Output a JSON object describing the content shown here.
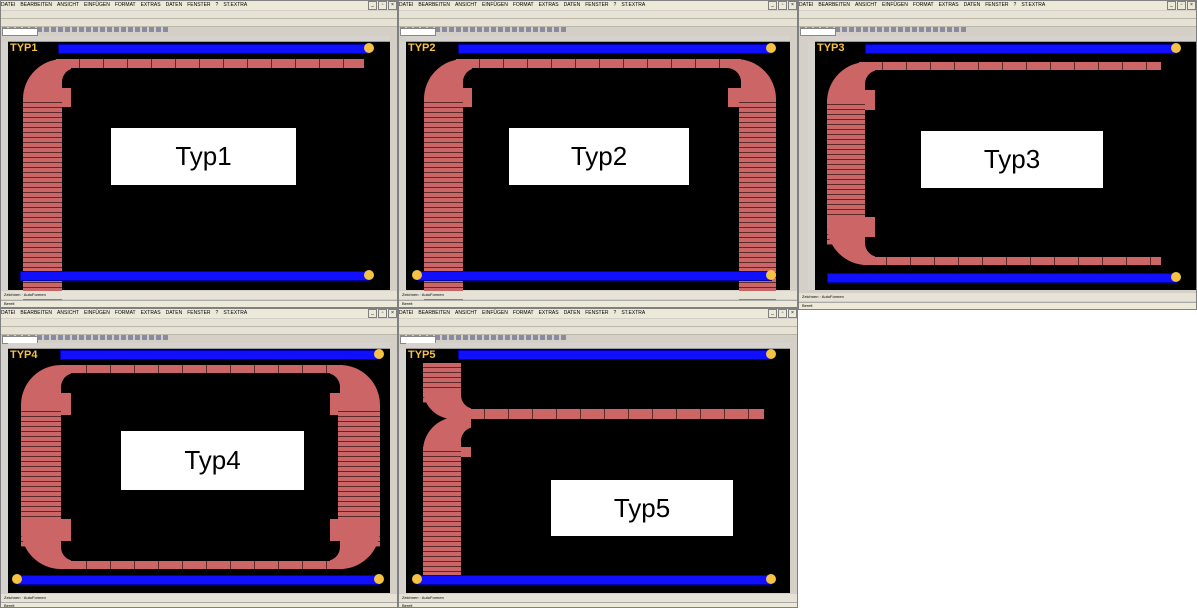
{
  "menu": [
    "Datei",
    "Bearbeiten",
    "Ansicht",
    "Einfügen",
    "Format",
    "Extras",
    "Daten",
    "Fenster",
    "?",
    "ST.Extra"
  ],
  "window_controls": [
    "_",
    "▫",
    "×"
  ],
  "zoom": "100%",
  "drawbar_text": "Zeichnen · AutoFormen",
  "status_text": "Bereit",
  "windows": [
    {
      "tag": "TYP1",
      "label": "Typ1"
    },
    {
      "tag": "TYP2",
      "label": "Typ2"
    },
    {
      "tag": "TYP3",
      "label": "Typ3"
    },
    {
      "tag": "TYP4",
      "label": "Typ4"
    },
    {
      "tag": "TYP5",
      "label": "Typ5"
    }
  ],
  "colors": {
    "sheet_bg": "#000000",
    "rail": "#1010ff",
    "track": "#cc6666",
    "cap": "#f5c242"
  }
}
